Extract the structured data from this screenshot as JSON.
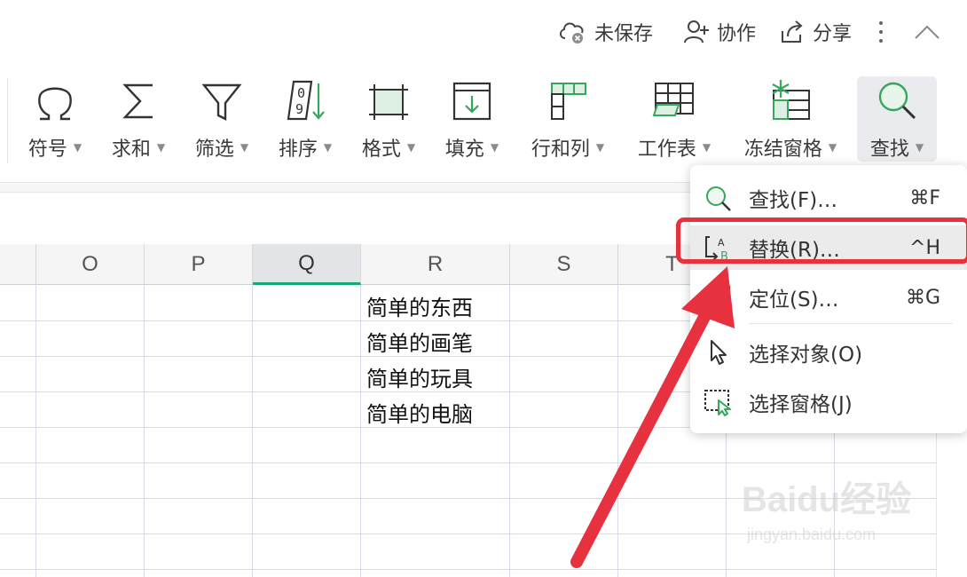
{
  "topbar": {
    "unsaved": "未保存",
    "collab": "协作",
    "share": "分享"
  },
  "ribbon": {
    "tools": [
      {
        "label": "符号",
        "icon": "omega-icon"
      },
      {
        "label": "求和",
        "icon": "sigma-icon"
      },
      {
        "label": "筛选",
        "icon": "filter-icon"
      },
      {
        "label": "排序",
        "icon": "sort-icon"
      },
      {
        "label": "格式",
        "icon": "format-icon"
      },
      {
        "label": "填充",
        "icon": "fill-icon"
      },
      {
        "label": "行和列",
        "icon": "rows-cols-icon"
      },
      {
        "label": "工作表",
        "icon": "worksheet-icon"
      },
      {
        "label": "冻结窗格",
        "icon": "freeze-panes-icon"
      },
      {
        "label": "查找",
        "icon": "search-icon"
      }
    ],
    "active": "查找"
  },
  "grid": {
    "columns": [
      "O",
      "P",
      "Q",
      "R",
      "S",
      "T"
    ],
    "selected_column": "Q",
    "cells": [
      {
        "column": "R",
        "row": 1,
        "value": "简单的东西"
      },
      {
        "column": "R",
        "row": 2,
        "value": "简单的画笔"
      },
      {
        "column": "R",
        "row": 3,
        "value": "简单的玩具"
      },
      {
        "column": "R",
        "row": 4,
        "value": "简单的电脑"
      }
    ]
  },
  "menu": {
    "items": [
      {
        "label": "查找(F)…",
        "shortcut": "⌘F",
        "icon": "search-icon"
      },
      {
        "label": "替换(R)…",
        "shortcut": "^H",
        "icon": "replace-icon"
      },
      {
        "label": "定位(S)…",
        "shortcut": "⌘G",
        "icon": "locate-icon"
      },
      {
        "label": "选择对象(O)",
        "shortcut": "",
        "icon": "cursor-icon"
      },
      {
        "label": "选择窗格(J)",
        "shortcut": "",
        "icon": "selection-pane-icon"
      }
    ],
    "highlighted": "替换(R)…"
  },
  "annotation": {
    "color": "#e8313f"
  },
  "watermark": {
    "brand": "Baidu经验",
    "url": "jingyan.baidu.com"
  },
  "colors": {
    "accent": "#1aa872",
    "icon_green": "#3aa55c"
  }
}
